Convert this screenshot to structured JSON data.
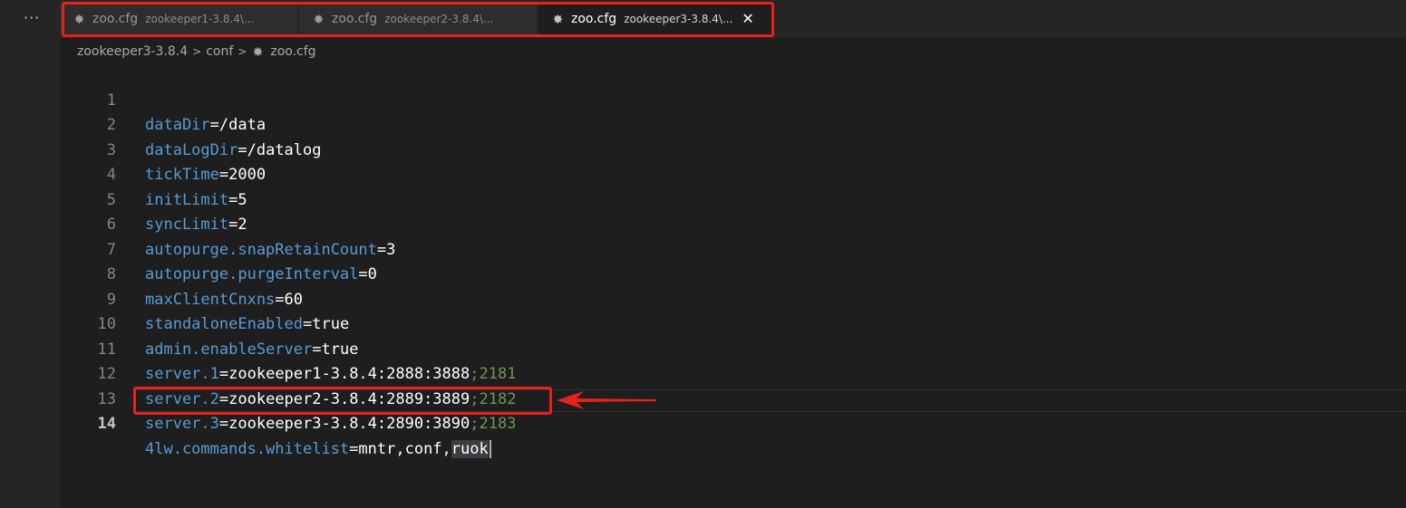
{
  "tabs": [
    {
      "name": "zoo.cfg",
      "desc": "zookeeper1-3.8.4\\...",
      "active": false,
      "icon": "gear-icon"
    },
    {
      "name": "zoo.cfg",
      "desc": "zookeeper2-3.8.4\\...",
      "active": false,
      "icon": "gear-icon"
    },
    {
      "name": "zoo.cfg",
      "desc": "zookeeper3-3.8.4\\...",
      "active": true,
      "icon": "gear-icon",
      "close": "✕"
    }
  ],
  "more_actions": "···",
  "breadcrumb": {
    "items": [
      "zookeeper3-3.8.4",
      "conf",
      "zoo.cfg"
    ],
    "separator": ">"
  },
  "editor": {
    "lines": [
      {
        "n": "1",
        "key": "dataDir",
        "eq": "=",
        "value": "/data"
      },
      {
        "n": "2",
        "key": "dataLogDir",
        "eq": "=",
        "value": "/datalog"
      },
      {
        "n": "3",
        "key": "tickTime",
        "eq": "=",
        "value": "2000"
      },
      {
        "n": "4",
        "key": "initLimit",
        "eq": "=",
        "value": "5"
      },
      {
        "n": "5",
        "key": "syncLimit",
        "eq": "=",
        "value": "2"
      },
      {
        "n": "6",
        "key": "autopurge.snapRetainCount",
        "eq": "=",
        "value": "3"
      },
      {
        "n": "7",
        "key": "autopurge.purgeInterval",
        "eq": "=",
        "value": "0"
      },
      {
        "n": "8",
        "key": "maxClientCnxns",
        "eq": "=",
        "value": "60"
      },
      {
        "n": "9",
        "key": "standaloneEnabled",
        "eq": "=",
        "value": "true"
      },
      {
        "n": "10",
        "key": "admin.enableServer",
        "eq": "=",
        "value": "true"
      },
      {
        "n": "11",
        "key": "server.1",
        "eq": "=",
        "value": "zookeeper1-3.8.4:2888:3888",
        "comment": ";2181"
      },
      {
        "n": "12",
        "key": "server.2",
        "eq": "=",
        "value": "zookeeper2-3.8.4:2889:3889",
        "comment": ";2182"
      },
      {
        "n": "13",
        "key": "server.3",
        "eq": "=",
        "value": "zookeeper3-3.8.4:2890:3890",
        "comment": ";2183"
      },
      {
        "n": "14",
        "key": "4lw.commands.whitelist",
        "eq": "=",
        "value": "mntr,conf,",
        "selected": "ruok",
        "current": true
      }
    ]
  },
  "colors": {
    "background": "#1e1e1e",
    "key": "#569cd6",
    "value": "#ffffff",
    "comment": "#6a9955",
    "annotation": "#e8221b"
  }
}
